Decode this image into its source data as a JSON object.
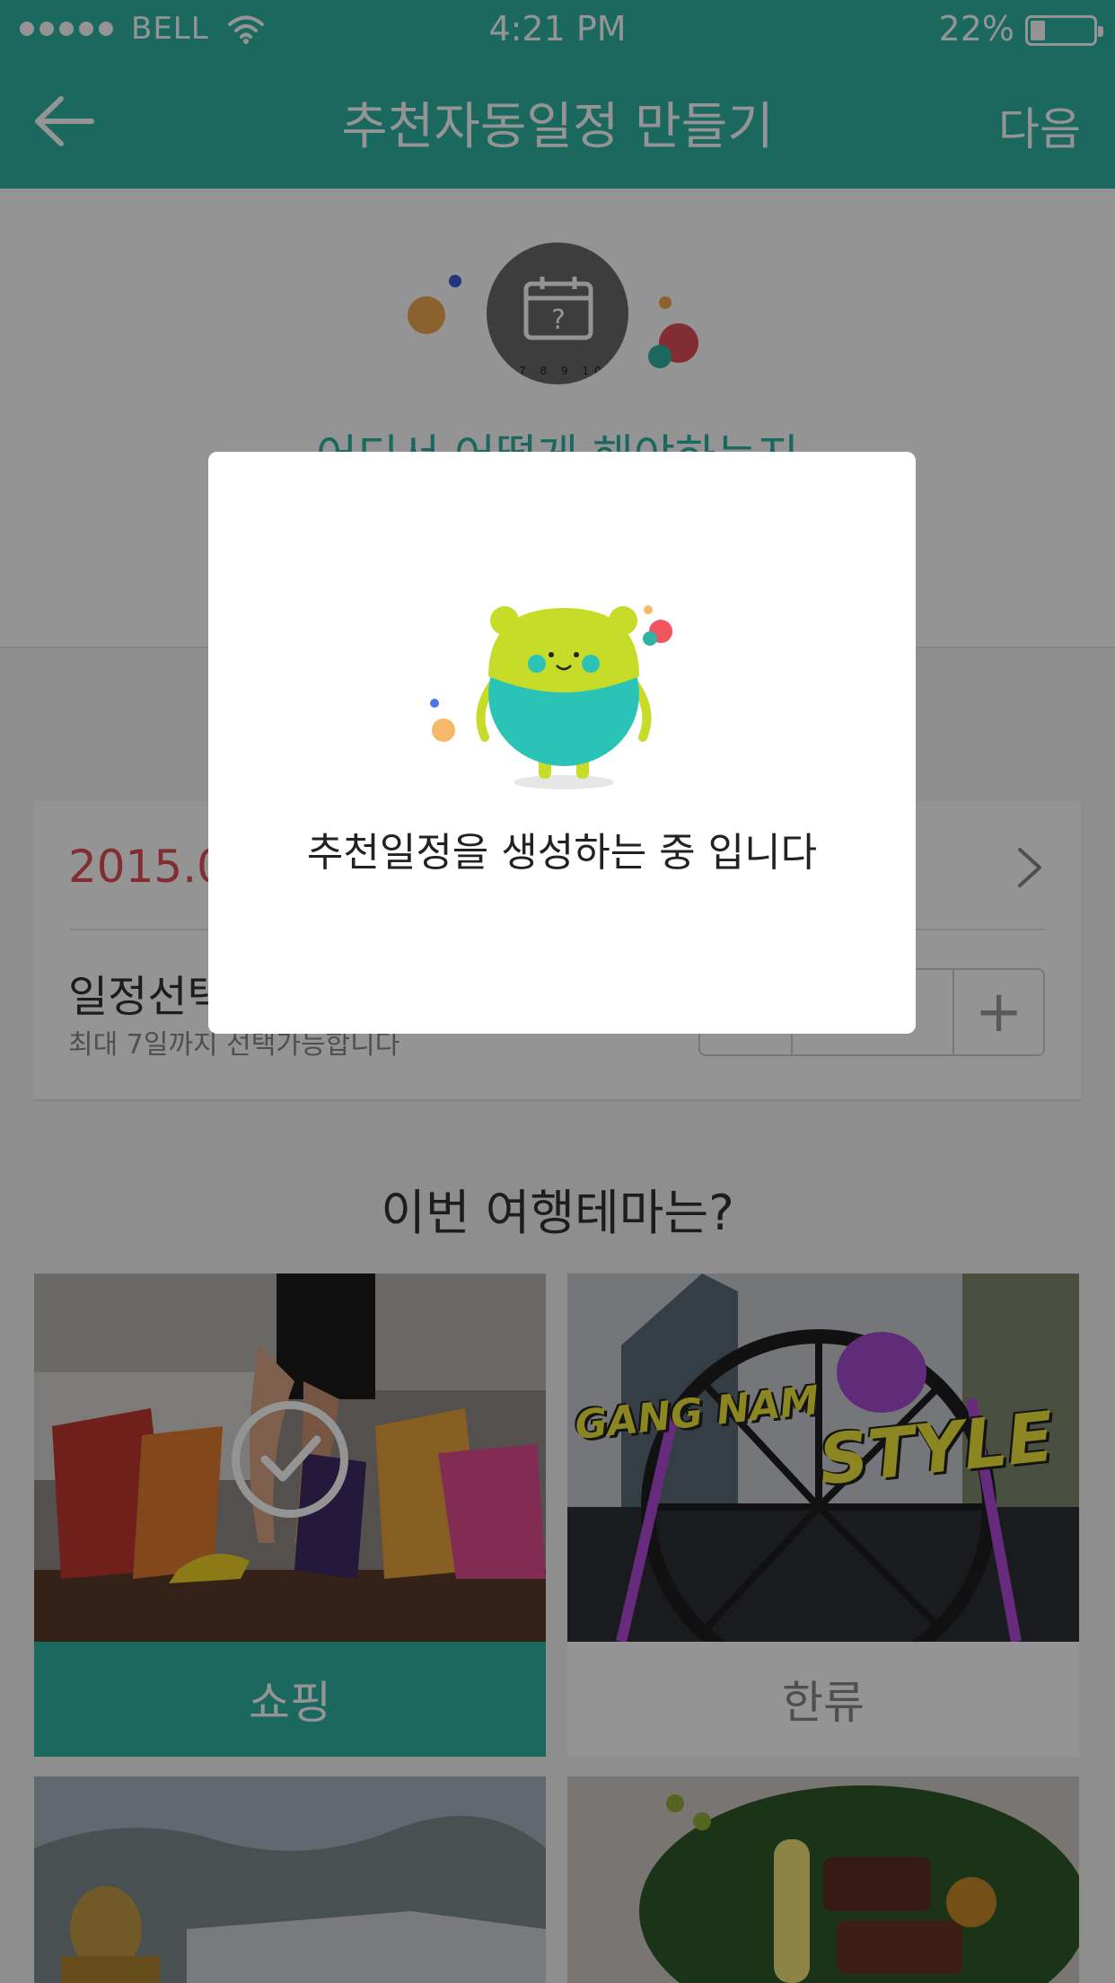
{
  "status_bar": {
    "carrier": "BELL",
    "time": "4:21 PM",
    "battery_percent": "22%",
    "battery_level": 0.22
  },
  "header": {
    "title": "추천자동일정 만들기",
    "next_label": "다음",
    "back_icon": "arrow-left-icon",
    "bg_color": "#2fb3a4"
  },
  "hero": {
    "headline": "어디서 어떻게 해야하는지"
  },
  "date_card": {
    "date_value": "2015.0",
    "select_label": "일정선택",
    "select_hint": "최대 7일까지 선택가능합니다",
    "stepper_plus": "+"
  },
  "theme": {
    "title": "이번 여행테마는?",
    "items": [
      {
        "label": "쇼핑",
        "selected": true
      },
      {
        "label": "한류",
        "selected": false,
        "photo_text_1": "GANG NAM",
        "photo_text_2": "STYLE"
      }
    ]
  },
  "modal": {
    "message": "추천일정을 생성하는 중 입니다"
  }
}
